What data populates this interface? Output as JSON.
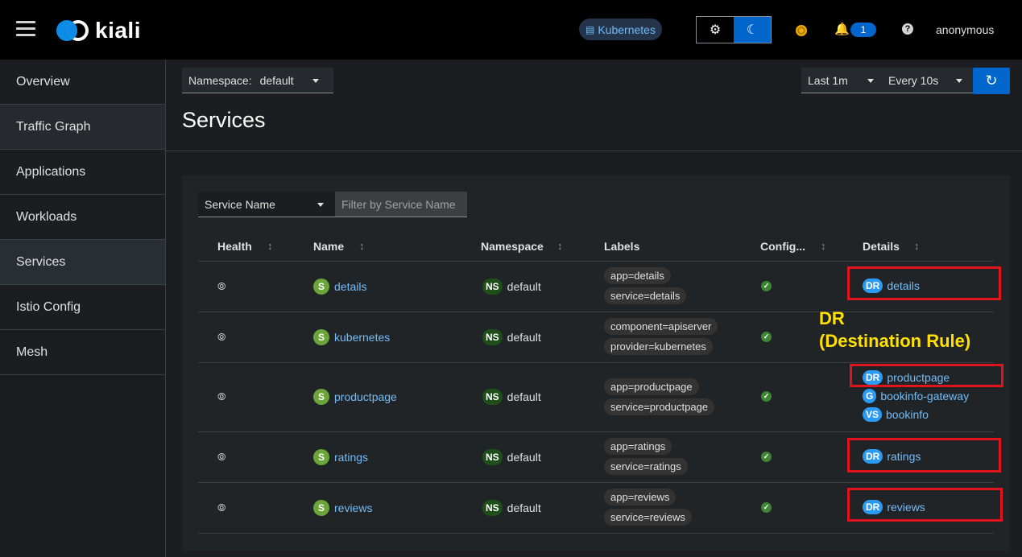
{
  "header": {
    "brand": "kiali",
    "cluster_label": "Kubernetes",
    "notifications_count": "1",
    "user": "anonymous"
  },
  "sidebar": {
    "items": [
      {
        "label": "Overview"
      },
      {
        "label": "Traffic Graph"
      },
      {
        "label": "Applications"
      },
      {
        "label": "Workloads"
      },
      {
        "label": "Services"
      },
      {
        "label": "Istio Config"
      },
      {
        "label": "Mesh"
      }
    ]
  },
  "toolbar": {
    "namespace_label": "Namespace:",
    "namespace_value": "default",
    "time_range": "Last 1m",
    "refresh_interval": "Every 10s"
  },
  "page": {
    "title": "Services"
  },
  "filter": {
    "type": "Service Name",
    "placeholder": "Filter by Service Name"
  },
  "table": {
    "columns": [
      "Health",
      "Name",
      "Namespace",
      "Labels",
      "Config...",
      "Details"
    ],
    "rows": [
      {
        "name": "details",
        "namespace": "default",
        "labels": [
          "app=details",
          "service=details"
        ],
        "details": [
          {
            "type": "DR",
            "name": "details"
          }
        ]
      },
      {
        "name": "kubernetes",
        "namespace": "default",
        "labels": [
          "component=apiserver",
          "provider=kubernetes"
        ],
        "details": []
      },
      {
        "name": "productpage",
        "namespace": "default",
        "labels": [
          "app=productpage",
          "service=productpage"
        ],
        "details": [
          {
            "type": "DR",
            "name": "productpage"
          },
          {
            "type": "G",
            "name": "bookinfo-gateway"
          },
          {
            "type": "VS",
            "name": "bookinfo"
          }
        ]
      },
      {
        "name": "ratings",
        "namespace": "default",
        "labels": [
          "app=ratings",
          "service=ratings"
        ],
        "details": [
          {
            "type": "DR",
            "name": "ratings"
          }
        ]
      },
      {
        "name": "reviews",
        "namespace": "default",
        "labels": [
          "app=reviews",
          "service=reviews"
        ],
        "details": [
          {
            "type": "DR",
            "name": "reviews"
          }
        ]
      }
    ]
  },
  "badges": {
    "service": "S",
    "namespace": "NS"
  },
  "annotation": {
    "line1": "DR",
    "line2": "(Destination Rule)",
    "color": "#ffe000",
    "box_color": "#e1141e"
  }
}
